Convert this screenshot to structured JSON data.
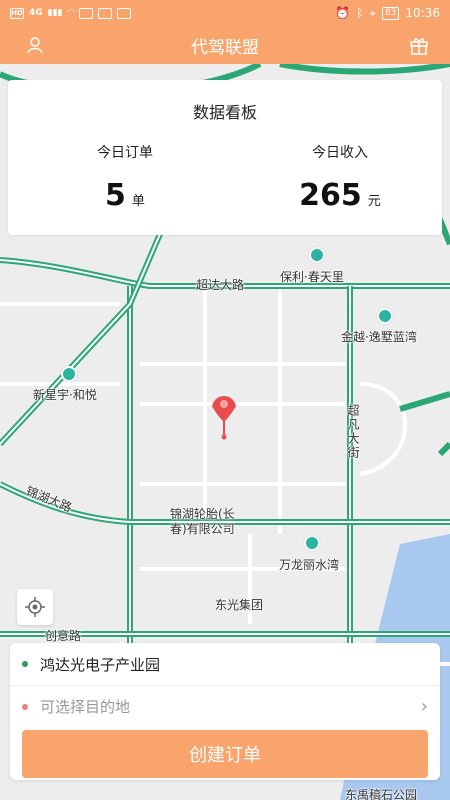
{
  "status_bar": {
    "time": "10:36",
    "battery": "83",
    "left_icons": [
      "HD",
      "4G"
    ]
  },
  "header": {
    "title": "代驾联盟",
    "left_icon": "user-icon",
    "right_icon": "gift-icon"
  },
  "board": {
    "title": "数据看板",
    "orders": {
      "label": "今日订单",
      "value": "5",
      "unit": "单"
    },
    "income": {
      "label": "今日收入",
      "value": "265",
      "unit": "元"
    }
  },
  "map": {
    "labels": {
      "chaoda_road": "超达大路",
      "poly": "保利·春天里",
      "jinyue": "金越·逸墅蓝湾",
      "xinxingyu": "新星宇·和悦",
      "chaofan": "超凡大街",
      "jinhu_road": "锦湖大路",
      "jinhu_tire_1": "锦湖轮胎(长",
      "jinhu_tire_2": "春)有限公司",
      "wanlong": "万龙丽水湾",
      "dongguang": "东光集团",
      "chuangye_road": "创意路",
      "donghe": "东禹稿石公园"
    },
    "accent_road_color": "#2aa774",
    "pin_color": "#e84c4c",
    "water_color": "#a9c8ef"
  },
  "panel": {
    "from": "鸿达光电子产业园",
    "to_placeholder": "可选择目的地",
    "create_label": "创建订单"
  },
  "colors": {
    "brand": "#f9a46c"
  }
}
